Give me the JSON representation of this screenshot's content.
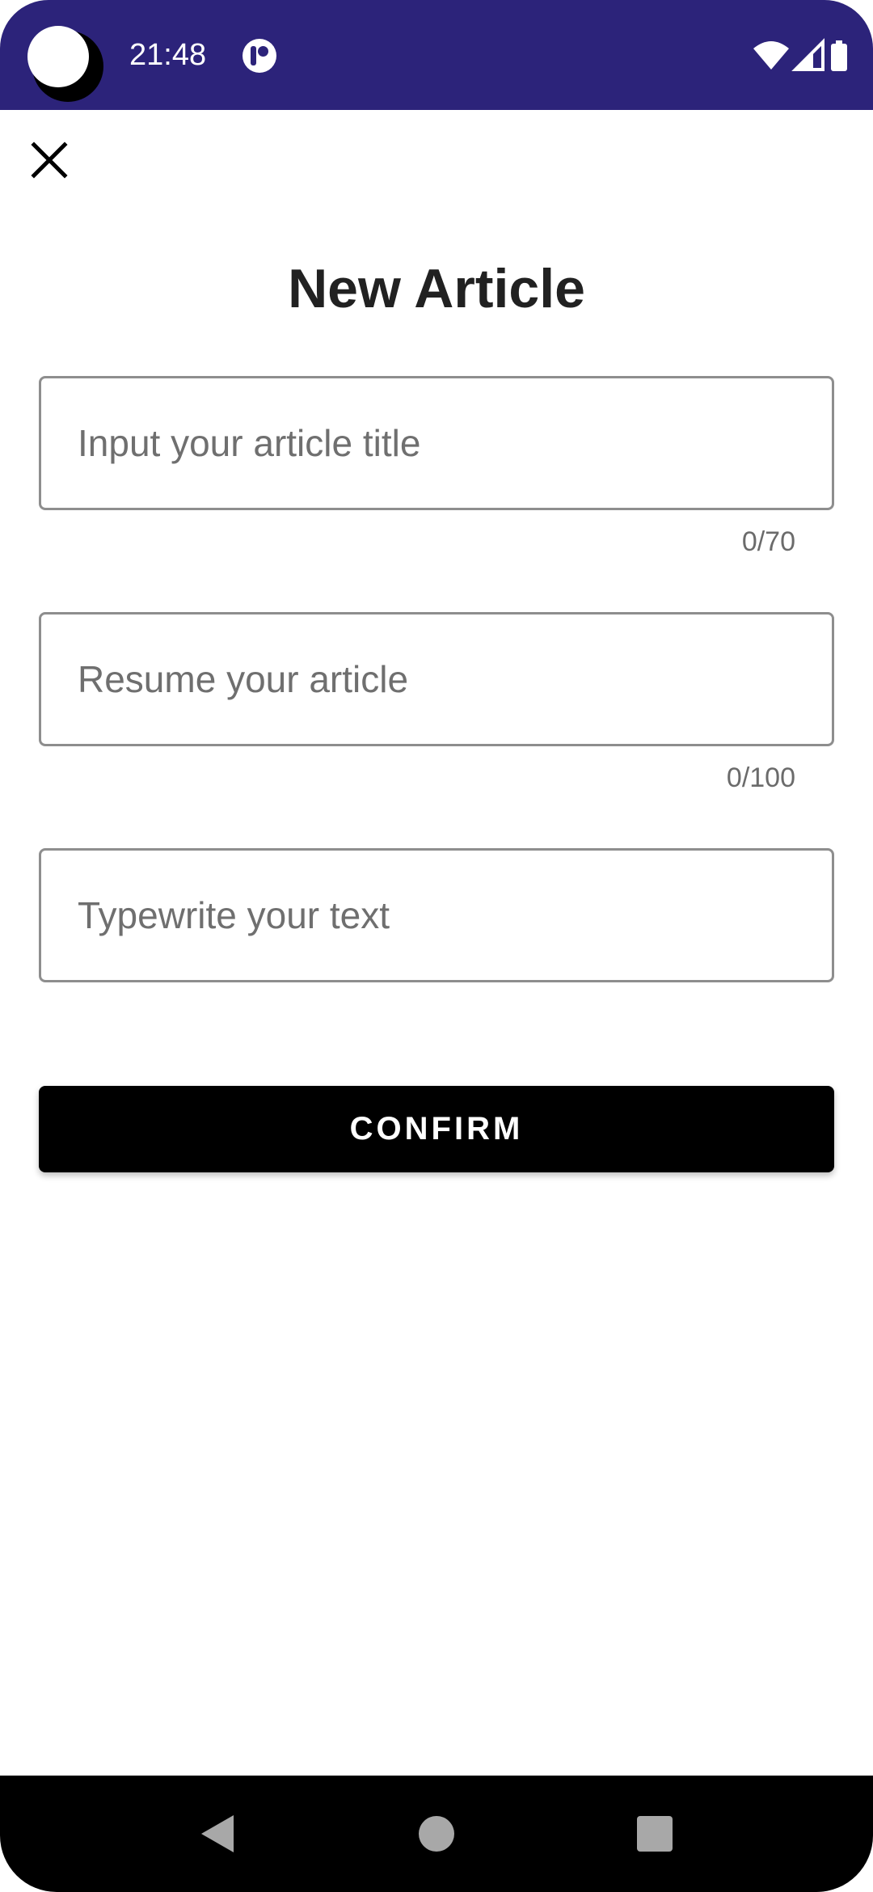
{
  "status_bar": {
    "time": "21:48"
  },
  "header": {
    "close_icon": "close-icon"
  },
  "form": {
    "title": "New Article",
    "title_field": {
      "placeholder": "Input your article title",
      "value": "",
      "counter": "0/70"
    },
    "resume_field": {
      "placeholder": "Resume your article",
      "value": "",
      "counter": "0/100"
    },
    "text_field": {
      "placeholder": "Typewrite your text",
      "value": ""
    },
    "confirm_label": "CONFIRM"
  },
  "colors": {
    "status_bar": "#2c237a",
    "button": "#000000",
    "title": "#212121"
  }
}
